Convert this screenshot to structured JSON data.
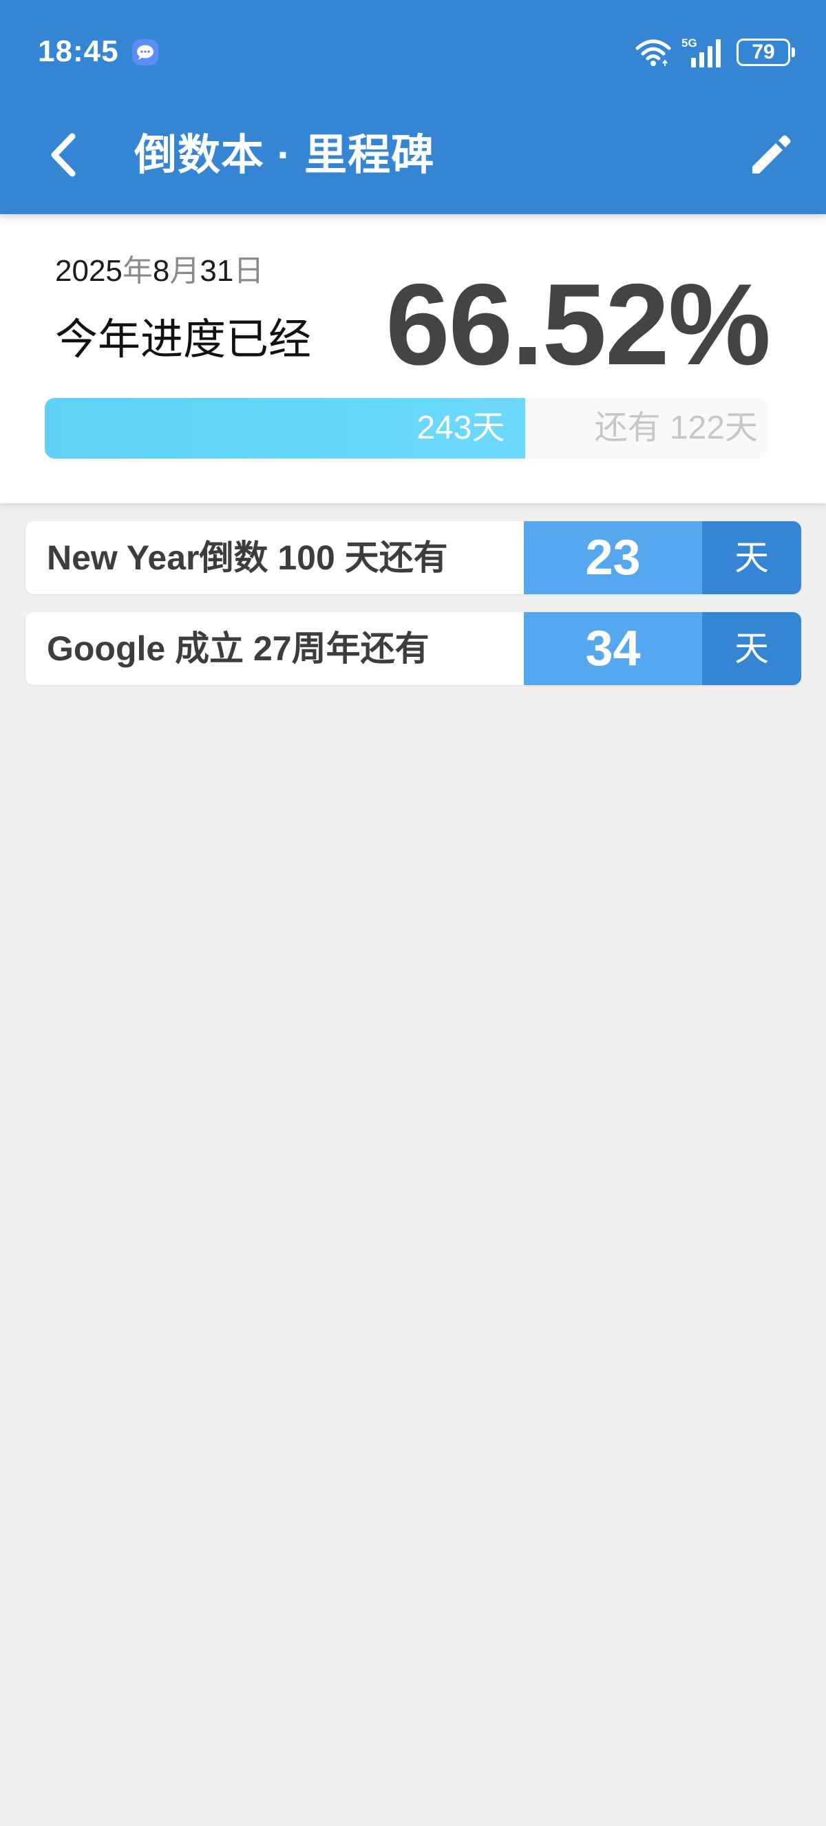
{
  "status_bar": {
    "time": "18:45",
    "network": "5G",
    "battery": "79",
    "icons": [
      "message-icon",
      "wifi-icon",
      "signal-icon",
      "battery-icon"
    ]
  },
  "toolbar": {
    "title": "倒数本 · 里程碑",
    "icons": [
      "back-arrow-icon",
      "edit-pencil-icon"
    ]
  },
  "progress": {
    "date_prefix_year": "2025",
    "date_year_unit": "年",
    "date_month": "8",
    "date_month_unit": "月",
    "date_day": "31",
    "date_day_unit": "日",
    "label": "今年进度已经",
    "percent": "66.52%",
    "elapsed_text": "243天",
    "remaining_text": "还有 122天",
    "fill_fraction": 0.6652
  },
  "milestones": [
    {
      "text": "New Year倒数 100 天还有",
      "count": "23",
      "unit": "天"
    },
    {
      "text": "Google 成立 27周年还有",
      "count": "34",
      "unit": "天"
    }
  ],
  "colors": {
    "header": "#3485d4",
    "progress_fill": "#62d6fa",
    "count_bg": "#55a7f0",
    "unit_bg": "#3485d4",
    "background": "#f0efee"
  }
}
